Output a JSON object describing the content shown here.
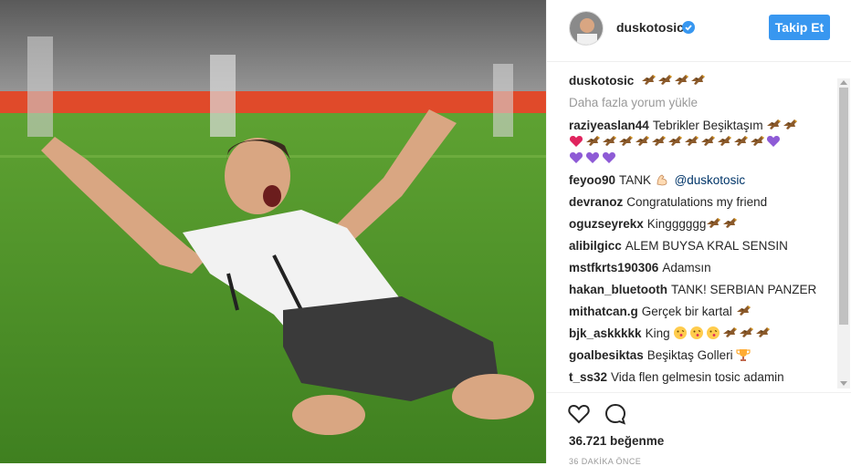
{
  "post": {
    "author": "duskotosic",
    "follow_label": "Takip Et",
    "caption_user": "duskotosic",
    "load_more": "Daha fazla yorum yükle",
    "likes": "36.721 beğenme",
    "time": "36 DAKİKA ÖNCE"
  },
  "comments": [
    {
      "user": "raziyeaslan44",
      "text": "Tebrikler Beşiktaşım"
    },
    {
      "user": "feyoo90",
      "text": "TANK",
      "mention": "@duskotosic"
    },
    {
      "user": "devranoz",
      "text": "Congratulations my friend"
    },
    {
      "user": "oguzseyrekx",
      "text": "Kingggggg"
    },
    {
      "user": "alibilgicc",
      "text": "ALEM BUYSA KRAL SENSIN"
    },
    {
      "user": "mstfkrts190306",
      "text": "Adamsın"
    },
    {
      "user": "hakan_bluetooth",
      "text": "TANK! SERBIAN PANZER"
    },
    {
      "user": "mithatcan.g",
      "text": "Gerçek bir kartal"
    },
    {
      "user": "bjk_askkkkk",
      "text": "King"
    },
    {
      "user": "goalbesiktas",
      "text": "Beşiktaş Golleri"
    },
    {
      "user": "t_ss32",
      "text": "Vida flen gelmesin tosic adamin"
    }
  ],
  "colors": {
    "accent": "#3897f0",
    "text": "#262626",
    "muted": "#999999",
    "verified": "#3897f0",
    "heart_purple": "#8e5bd6",
    "heart_red": "#e0245e"
  },
  "icons": [
    "eagle-emoji",
    "purple-heart-emoji",
    "red-heart-emoji",
    "flexed-biceps-emoji",
    "kiss-face-emoji",
    "trophy-emoji",
    "heart-icon",
    "comment-icon",
    "verified-badge-icon"
  ]
}
